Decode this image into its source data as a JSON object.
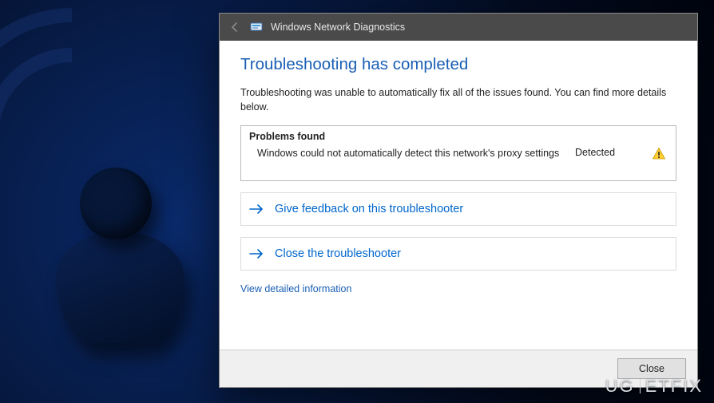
{
  "titlebar": {
    "window_title": "Windows Network Diagnostics"
  },
  "content": {
    "heading": "Troubleshooting has completed",
    "subtext": "Troubleshooting was unable to automatically fix all of the issues found. You can find more details below.",
    "problems_header": "Problems found",
    "problem": {
      "description": "Windows could not automatically detect this network's proxy settings",
      "status": "Detected"
    },
    "actions": {
      "feedback": "Give feedback on this troubleshooter",
      "close_ts": "Close the troubleshooter"
    },
    "detailed_link": "View detailed information"
  },
  "footer": {
    "close_label": "Close"
  },
  "watermark": {
    "brand_left": "UG",
    "brand_mid": "ET",
    "brand_right": "FIX"
  }
}
